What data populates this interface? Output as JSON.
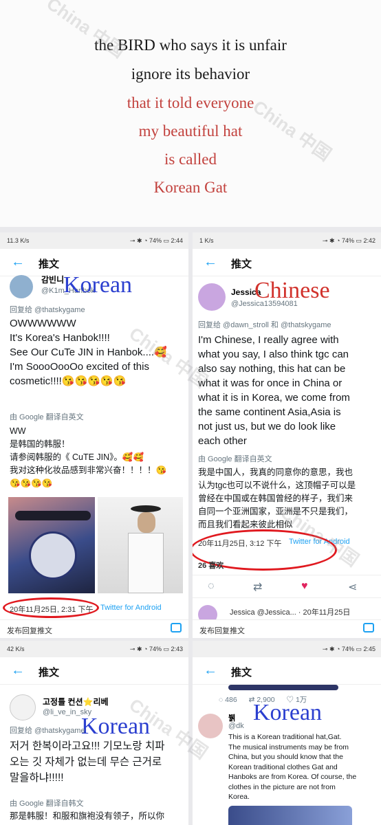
{
  "banner": {
    "lines": [
      "the BIRD who says it is unfair",
      "ignore its behavior",
      "that it told everyone",
      "my beautiful hat",
      "is called",
      "Korean Gat"
    ]
  },
  "panel1": {
    "status_right": "2:44",
    "status_left": "11.3 K/s",
    "battery": "74%",
    "title": "推文",
    "user_name": "감빈니",
    "handle": "@K1m_Hanbok",
    "tag": "Korean",
    "reply_to": "回复给 @thatskygame",
    "tweet_lines": [
      "OWWWWWW",
      "It's Korea's Hanbok!!!!",
      "See Our CuTe JIN in Hanbok....🥰",
      "I'm SoooOooOo excited of this",
      "cosmetic!!!!😘😘😘😘😘"
    ],
    "translate": "由 Google 翻译自英文",
    "zh_lines": [
      "WW",
      "是韩国的韩服！",
      "请参阅韩服的《 CuTE JIN》。🥰🥰",
      "我对这种化妆品感到非常兴奋！！！！😘",
      "😘😘😘😘"
    ],
    "timestamp": "20年11月25日, 2:31 下午",
    "client": "Twitter for Android",
    "compose": "发布回复推文"
  },
  "panel2": {
    "status_right": "2:42",
    "status_left": "1 K/s",
    "battery": "74%",
    "title": "推文",
    "user_name": "Jessica",
    "handle": "@Jessica13594081",
    "tag": "Chinese",
    "reply_to": "回复给 @dawn_stroll 和 @thatskygame",
    "tweet_lines": [
      "I'm Chinese, I really agree with",
      "what you say, I also think tgc can",
      "also say nothing, this hat can be",
      "what it was for once in China or",
      "what it is in Korea, we come from",
      "the same continent Asia,Asia is",
      "not just us, but we do look like",
      "each other"
    ],
    "translate": "由 Google 翻译自英文",
    "zh_lines": [
      "我是中国人，我真的同意你的意思，我也",
      "认为tgc也可以不说什么，这顶帽子可以是",
      "曾经在中国或在韩国曾经的样子，我们来",
      "自同一个亚洲国家，亚洲是不只是我们，",
      "而且我们看起来彼此相似"
    ],
    "timestamp": "20年11月25日, 3:12 下午",
    "client": "Twitter for Android",
    "likes": "26 喜欢",
    "reply_preview": "Jessica @Jessica... · 20年11月25日",
    "compose": "发布回复推文"
  },
  "panel3": {
    "status_right": "2:43",
    "status_left": "42 K/s",
    "battery": "74%",
    "title": "推文",
    "user_name": "고정틀 컨션⭐리베",
    "handle": "@li_ve_in_sky",
    "tag": "Korean",
    "reply_to": "回复给 @thatskygame",
    "tweet_lines": [
      "저거 한복이라고요!!! 기모노랑 치파",
      "오는 깃 자체가 없는데 무슨 근거로",
      "말을하냐!!!!!"
    ],
    "translate": "由 Google 翻译自韩文",
    "zh_lines": [
      "那是韩服！和服和旗袍没有领子，所以你"
    ]
  },
  "panel4": {
    "status_right": "2:45",
    "battery": "74%",
    "title": "推文",
    "stats": [
      "486",
      "2,900",
      "1万"
    ],
    "user_name": "뷁",
    "handle": "@dk",
    "tag": "Korean",
    "tweet_lines": [
      "This is a Korean traditional hat,Gat.",
      "The musical instruments may be from",
      "China, but you should know that the",
      "Korean traditional clothes Gat and",
      "Hanboks are from Korea. Of course, the",
      "clothes in the picture are not from",
      "Korea."
    ]
  },
  "watermark": "China 中国",
  "colors": {
    "twitter_blue": "#1da1f2",
    "annotation_red": "#e0191f",
    "tag_blue": "#2b3fcf",
    "banner_red": "#c2413d"
  }
}
